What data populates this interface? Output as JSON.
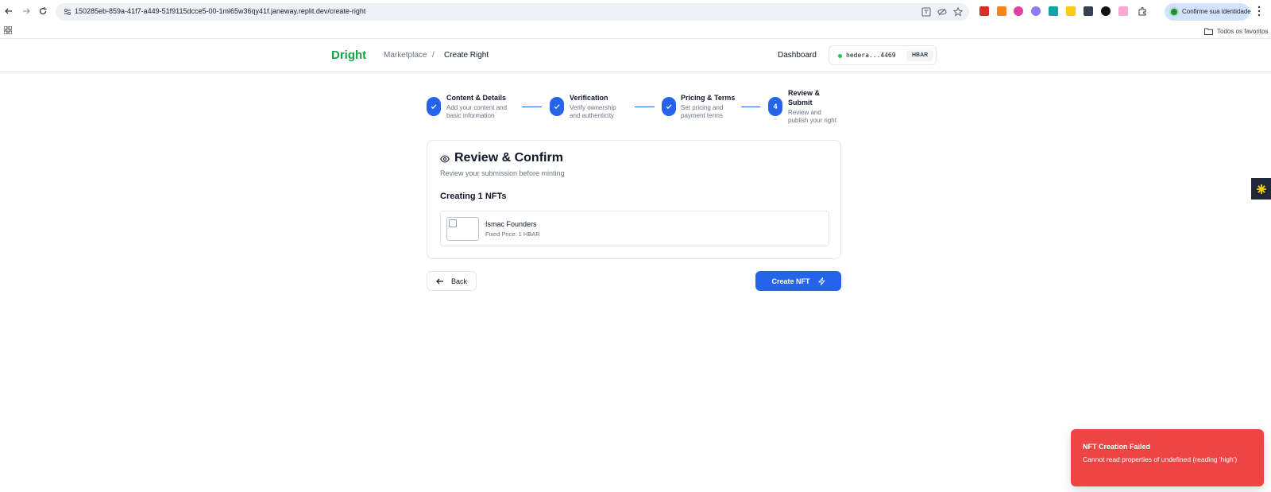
{
  "browser": {
    "url": "150285eb-859a-41f7-a449-51f9115dcce5-00-1ml65w36qy41f.janeway.replit.dev/create-right",
    "profile_label": "Confirme sua identidade",
    "bookmarks_folder": "Todos os favoritos"
  },
  "header": {
    "brand": "Dright",
    "breadcrumb_parent": "Marketplace",
    "breadcrumb_sep": "/",
    "breadcrumb_current": "Create Right",
    "dashboard_link": "Dashboard",
    "wallet_address": "hedera...4469",
    "wallet_network": "HBAR"
  },
  "stepper": {
    "steps": [
      {
        "title": "Content & Details",
        "desc_1": "Add your content and",
        "desc_2": "basic information",
        "state": "done"
      },
      {
        "title": "Verification",
        "desc_1": "Verify ownership",
        "desc_2": "and authenticity",
        "state": "done"
      },
      {
        "title": "Pricing & Terms",
        "desc_1": "Set pricing and",
        "desc_2": "payment terms",
        "state": "done"
      },
      {
        "number": "4",
        "title_1": "Review &",
        "title_2": "Submit",
        "desc_1": "Review and",
        "desc_2": "publish your right",
        "state": "active"
      }
    ]
  },
  "review": {
    "title": "Review & Confirm",
    "subtitle": "Review your submission before minting",
    "count_label": "Creating 1 NFTs",
    "item_name": "Ismac Founders",
    "item_price": "Fixed Price: 1 HBAR"
  },
  "actions": {
    "back_label": "Back",
    "create_label": "Create NFT"
  },
  "toast": {
    "title": "NFT Creation Failed",
    "message": "Cannot read properties of undefined (reading 'high')"
  },
  "colors": {
    "primary": "#2563eb",
    "brand": "#16a34a",
    "error": "#ef4444"
  }
}
